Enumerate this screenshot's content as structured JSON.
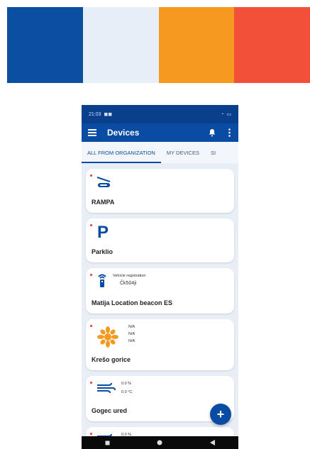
{
  "palette": {
    "colors": [
      "#0b4fa3",
      "#e6eef7",
      "#f59a1f",
      "#f25038"
    ]
  },
  "status": {
    "time": "21:03",
    "notif_icons": "◼◼",
    "signal": "◔",
    "battery": "▭"
  },
  "appbar": {
    "title": "Devices"
  },
  "tabs": [
    {
      "label": "ALL FROM ORGANIZATION",
      "active": true
    },
    {
      "label": "MY DEVICES",
      "active": false
    },
    {
      "label": "SI",
      "active": false
    }
  ],
  "cards": [
    {
      "name": "RAMPA",
      "icon": "barrier-gate-icon"
    },
    {
      "name": "Parklio",
      "icon": "parking-icon"
    },
    {
      "name": "Matija Location beacon ES",
      "icon": "beacon-icon",
      "label": "Vehicle registration",
      "value": "Čk504ji"
    },
    {
      "name": "Krešo gorice",
      "icon": "sun-icon",
      "values": [
        "N/A",
        "N/A",
        "N/A"
      ]
    },
    {
      "name": "Gogec ured",
      "icon": "wind-icon",
      "values": [
        "0.0 %",
        "0.0 °C"
      ]
    },
    {
      "name": "",
      "icon": "wind-icon",
      "values": [
        "0.0 %"
      ]
    }
  ],
  "fab": {
    "label": "+"
  },
  "colors": {
    "primary": "#0a4ca3",
    "status_dark": "#0a3f8c",
    "accent_red": "#e53935",
    "sun": "#f59a1f"
  }
}
